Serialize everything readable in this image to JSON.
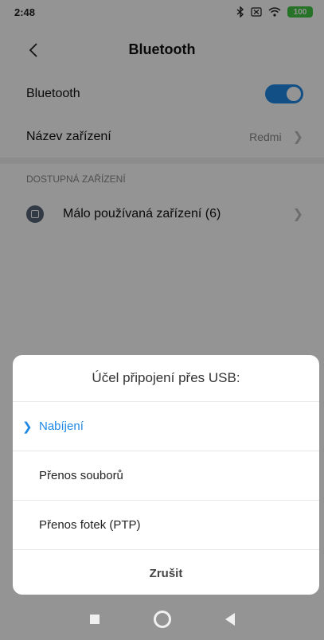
{
  "status_bar": {
    "time": "2:48",
    "battery": "100",
    "icons": [
      "bluetooth-icon",
      "sim-icon",
      "wifi-icon",
      "battery-icon"
    ]
  },
  "header": {
    "title": "Bluetooth"
  },
  "settings": {
    "bluetooth_label": "Bluetooth",
    "bluetooth_enabled": true,
    "device_name_label": "Název zařízení",
    "device_name_value": "Redmi",
    "section_header": "DOSTUPNÁ ZAŘÍZENÍ",
    "rare_devices_label": "Málo používaná zařízení (6)"
  },
  "dialog": {
    "title": "Účel připojení přes USB:",
    "options": [
      {
        "label": "Nabíjení",
        "selected": true
      },
      {
        "label": "Přenos souborů",
        "selected": false
      },
      {
        "label": "Přenos fotek (PTP)",
        "selected": false
      }
    ],
    "cancel_label": "Zrušit"
  },
  "colors": {
    "accent": "#1e88e5",
    "battery": "#43c444"
  }
}
